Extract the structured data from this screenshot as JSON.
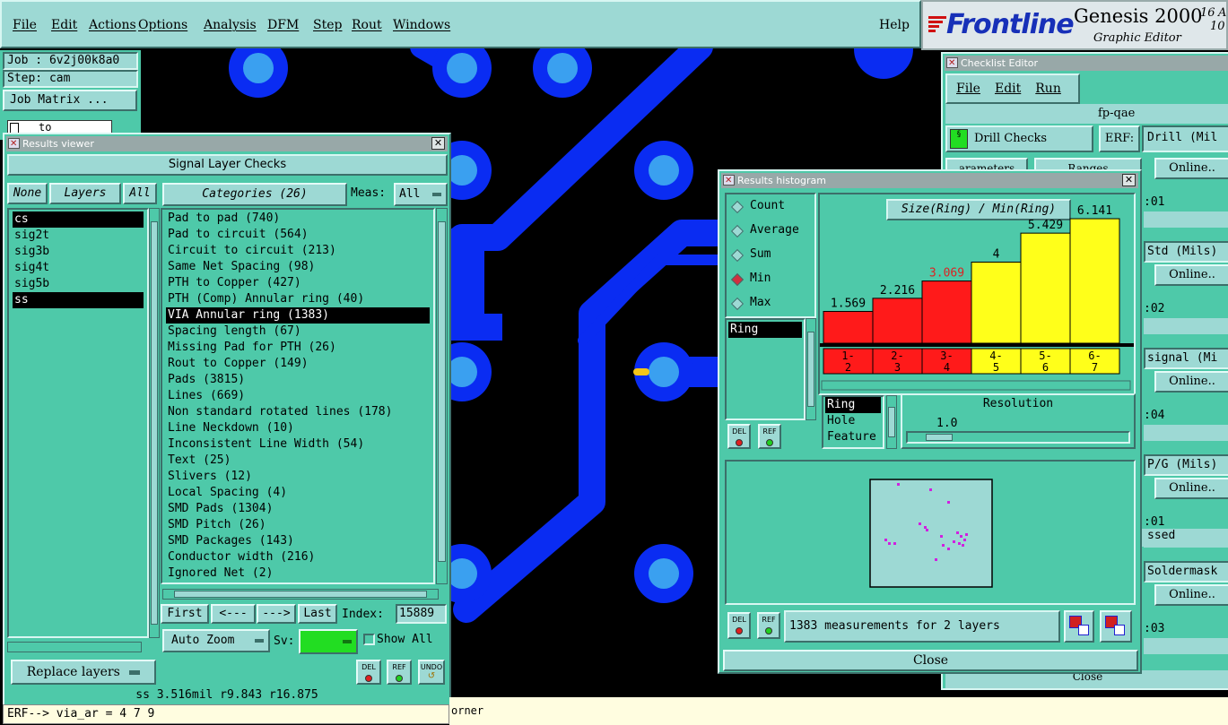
{
  "menubar": {
    "items": [
      "File",
      "Edit",
      "Actions",
      "Options",
      "Analysis",
      "DFM",
      "Step",
      "Rout",
      "Windows"
    ],
    "help": "Help"
  },
  "brand": {
    "logo": "Frontline",
    "product": "Genesis 2000",
    "subtitle": "Graphic Editor",
    "corner_top": "16",
    "corner_mid": "A",
    "corner_bottom": "10"
  },
  "job": {
    "job_label": "Job : 6v2j00k8a0",
    "step_label": "Step: cam",
    "matrix_button": "Job Matrix ...",
    "combo_value": "to"
  },
  "results_viewer": {
    "title": "Results viewer",
    "header": "Signal Layer Checks",
    "none_btn": "None",
    "layers_btn": "Layers",
    "all_btn": "All",
    "layers": [
      {
        "name": "cs",
        "selected": true
      },
      {
        "name": "sig2t",
        "selected": false
      },
      {
        "name": "sig3b",
        "selected": false
      },
      {
        "name": "sig4t",
        "selected": false
      },
      {
        "name": "sig5b",
        "selected": false
      },
      {
        "name": "ss",
        "selected": true
      }
    ],
    "categories_btn": "Categories (26)",
    "meas_label": "Meas:",
    "meas_value": "All",
    "categories": [
      {
        "label": "Pad to pad (740)",
        "selected": false
      },
      {
        "label": "Pad to circuit (564)",
        "selected": false
      },
      {
        "label": "Circuit to circuit (213)",
        "selected": false
      },
      {
        "label": "Same Net Spacing (98)",
        "selected": false
      },
      {
        "label": "PTH to Copper (427)",
        "selected": false
      },
      {
        "label": "PTH (Comp) Annular ring (40)",
        "selected": false
      },
      {
        "label": "VIA Annular ring (1383)",
        "selected": true
      },
      {
        "label": "Spacing length (67)",
        "selected": false
      },
      {
        "label": "Missing Pad for PTH (26)",
        "selected": false
      },
      {
        "label": "Rout to Copper (149)",
        "selected": false
      },
      {
        "label": "Pads (3815)",
        "selected": false
      },
      {
        "label": "Lines (669)",
        "selected": false
      },
      {
        "label": "Non standard rotated lines (178)",
        "selected": false
      },
      {
        "label": "Line Neckdown (10)",
        "selected": false
      },
      {
        "label": "Inconsistent Line Width (54)",
        "selected": false
      },
      {
        "label": "Text (25)",
        "selected": false
      },
      {
        "label": "Slivers (12)",
        "selected": false
      },
      {
        "label": "Local Spacing (4)",
        "selected": false
      },
      {
        "label": "SMD Pads (1304)",
        "selected": false
      },
      {
        "label": "SMD Pitch (26)",
        "selected": false
      },
      {
        "label": "SMD Packages (143)",
        "selected": false
      },
      {
        "label": "Conductor width (216)",
        "selected": false
      },
      {
        "label": "Ignored Net (2)",
        "selected": false
      }
    ],
    "nav": {
      "first": "First",
      "prev": "<---",
      "next": "--->",
      "last": "Last",
      "index_label": "Index:",
      "index_value": "15889"
    },
    "auto_zoom": "Auto Zoom",
    "sv_label": "Sv:",
    "show_all": "Show All",
    "replace_layers": "Replace layers",
    "del": "DEL",
    "ref": "REF",
    "undo": "UNDO",
    "status": "ss 3.516mil   r9.843  r16.875",
    "erf_line": "ERF--> via_ar = 4 7 9"
  },
  "histogram": {
    "title": "Results histogram",
    "modes": [
      {
        "label": "Count",
        "selected": false
      },
      {
        "label": "Average",
        "selected": false
      },
      {
        "label": "Sum",
        "selected": false
      },
      {
        "label": "Min",
        "selected": true
      },
      {
        "label": "Max",
        "selected": false
      }
    ],
    "list_items": [
      "Ring"
    ],
    "field_list": [
      {
        "label": "Ring",
        "selected": true
      },
      {
        "label": "Hole",
        "selected": false
      },
      {
        "label": "Feature",
        "selected": false
      }
    ],
    "resolution_label": "Resolution",
    "resolution_value": "1.0",
    "del": "DEL",
    "ref": "REF",
    "summary": "1383 measurements for 2 layers",
    "close": "Close"
  },
  "chart_data": {
    "type": "bar",
    "title": "Size(Ring) / Min(Ring)",
    "categories": [
      "1-2",
      "2-3",
      "3-4",
      "4-5",
      "5-6",
      "6-7"
    ],
    "values": [
      1.569,
      2.216,
      3.069,
      4,
      5.429,
      6.141
    ],
    "value_labels": [
      "1.569",
      "2.216",
      "3.069",
      "4",
      "5.429",
      "6.141"
    ],
    "colors": [
      "#ff1a1a",
      "#ff1a1a",
      "#ff1a1a",
      "#ffff1a",
      "#ffff1a",
      "#ffff1a"
    ],
    "label_colors": [
      "#000000",
      "#000000",
      "#dd2222",
      "#000000",
      "#000000",
      "#000000"
    ],
    "ylim": [
      0,
      7
    ]
  },
  "checklist": {
    "title": "Checklist Editor",
    "menu": [
      "File",
      "Edit",
      "Run"
    ],
    "name": "fp-qae",
    "drill_checks": "Drill Checks",
    "erf_label": "ERF:",
    "param_btn": "arameters",
    "ranges_btn": "Ranges",
    "rows": [
      {
        "field": "Drill (Mil",
        "online": "Online..",
        "time": ":01"
      },
      {
        "field": "Std (Mils)",
        "online": "Online..",
        "time": ":02"
      },
      {
        "field": "signal (Mi",
        "online": "Online..",
        "time": ":04"
      },
      {
        "field": "P/G (Mils)",
        "online": "Online..",
        "time": ":01"
      },
      {
        "field": "Soldermask",
        "online": "Online..",
        "time": ":03"
      }
    ],
    "passed_text": "ssed",
    "close": "Close"
  },
  "background_text": {
    "corner_label": "orner"
  },
  "colors": {
    "copper": "#0a2cf2",
    "pad_center": "#3aa0f0",
    "panel_teal": "#9dd9d4",
    "panel_green": "#4ec9a9"
  }
}
